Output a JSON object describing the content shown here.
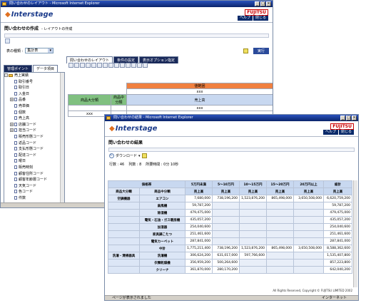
{
  "back_window": {
    "title": "問い合わせのレイアウト - Microsoft Internet Explorer",
    "product": "Interstage",
    "vendor": "FUJITSU",
    "header_buttons": [
      "ヘルプ",
      "閉じる"
    ],
    "page_title": "問い合わせの作成",
    "breadcrumb": "- レイアウトの作成",
    "table_type_label": "表の種類 :",
    "table_type_value": "集計表",
    "run_button": "実行",
    "tabs": [
      "問い合わせのレイアウト",
      "条件の設定",
      "表示オプション指定"
    ],
    "left_tabs": [
      "管理ポイント",
      "データ項目"
    ],
    "tree_root": "売上実績",
    "tree_items": [
      "取引番号",
      "取引日",
      "入金日",
      "品番",
      "売単価",
      "個数",
      "売上高",
      "店舗コード",
      "担当コード",
      "販売形態コード",
      "返品コード",
      "支払形態コード",
      "配達コード",
      "曜日",
      "販売時刻",
      "顧客住所コード",
      "顧客年齢層コード",
      "天気コード",
      "色コード",
      "件数"
    ],
    "grid": {
      "header": "値範囲",
      "row1": [
        "",
        "xxx"
      ],
      "row2": [
        "商品大分類",
        "商品中分類",
        "売上高"
      ],
      "cells": [
        "xxx",
        "xxx"
      ]
    }
  },
  "front_window": {
    "title": "問い合わせの結果 - Microsoft Internet Explorer",
    "product": "Interstage",
    "vendor": "FUJITSU",
    "header_buttons": [
      "ヘルプ",
      "閉じる"
    ],
    "page_title": "問い合わせの結果",
    "download_label": "ダウンロード",
    "summary": {
      "rows_label": "行数 : 46",
      "cols_label": "列数 : 8",
      "time_label": "所要時間 : 0分 10秒"
    },
    "table": {
      "range_header": "価格帯",
      "col_headers": [
        "5万円未満",
        "5〜10万円",
        "10〜15万円",
        "15〜20万円",
        "20万円以上",
        "総計"
      ],
      "dim_headers": [
        "商品大分類",
        "商品中分類"
      ],
      "measure": "売上高",
      "rows": [
        {
          "major": "空調機器",
          "minor": "エアコン",
          "vals": [
            "7,680,000",
            "738,196,200",
            "1,523,876,200",
            "865,498,000",
            "3,650,508,000",
            "6,620,759,200"
          ]
        },
        {
          "major": "",
          "minor": "扇風機",
          "vals": [
            "59,787,200",
            "",
            "",
            "",
            "",
            "59,787,200"
          ]
        },
        {
          "major": "",
          "minor": "除湿機",
          "vals": [
            "479,475,000",
            "",
            "",
            "",
            "",
            "479,475,000"
          ]
        },
        {
          "major": "",
          "minor": "電気・石油・ガス暖房機",
          "vals": [
            "435,057,200",
            "",
            "",
            "",
            "",
            "435,057,200"
          ]
        },
        {
          "major": "",
          "minor": "加湿器",
          "vals": [
            "254,040,600",
            "",
            "",
            "",
            "",
            "254,040,600"
          ]
        },
        {
          "major": "",
          "minor": "家具調こたつ",
          "vals": [
            "251,461,600",
            "",
            "",
            "",
            "",
            "251,461,600"
          ]
        },
        {
          "major": "",
          "minor": "電気カーペット",
          "vals": [
            "287,841,000",
            "",
            "",
            "",
            "",
            "287,841,000"
          ]
        },
        {
          "major": "",
          "minor": "中計",
          "vals": [
            "1,775,211,400",
            "738,196,200",
            "1,523,876,200",
            "865,498,000",
            "3,650,508,000",
            "8,588,362,600"
          ]
        },
        {
          "major": "洗濯・清掃器具",
          "minor": "洗濯機",
          "vals": [
            "306,624,200",
            "631,017,000",
            "597,766,600",
            "",
            "",
            "1,535,407,800"
          ]
        },
        {
          "major": "",
          "minor": "衣類乾燥機",
          "vals": [
            "356,959,200",
            "500,264,600",
            "",
            "",
            "",
            "857,223,800"
          ]
        },
        {
          "major": "",
          "minor": "クリーナ",
          "vals": [
            "361,870,000",
            "280,170,200",
            "",
            "",
            "",
            "642,040,200"
          ]
        }
      ]
    },
    "copyright": "All Rights Reserved, Copyright © FUJITSU LIMITED 2002",
    "status": "ページが表示されました",
    "zone": "インターネット"
  }
}
